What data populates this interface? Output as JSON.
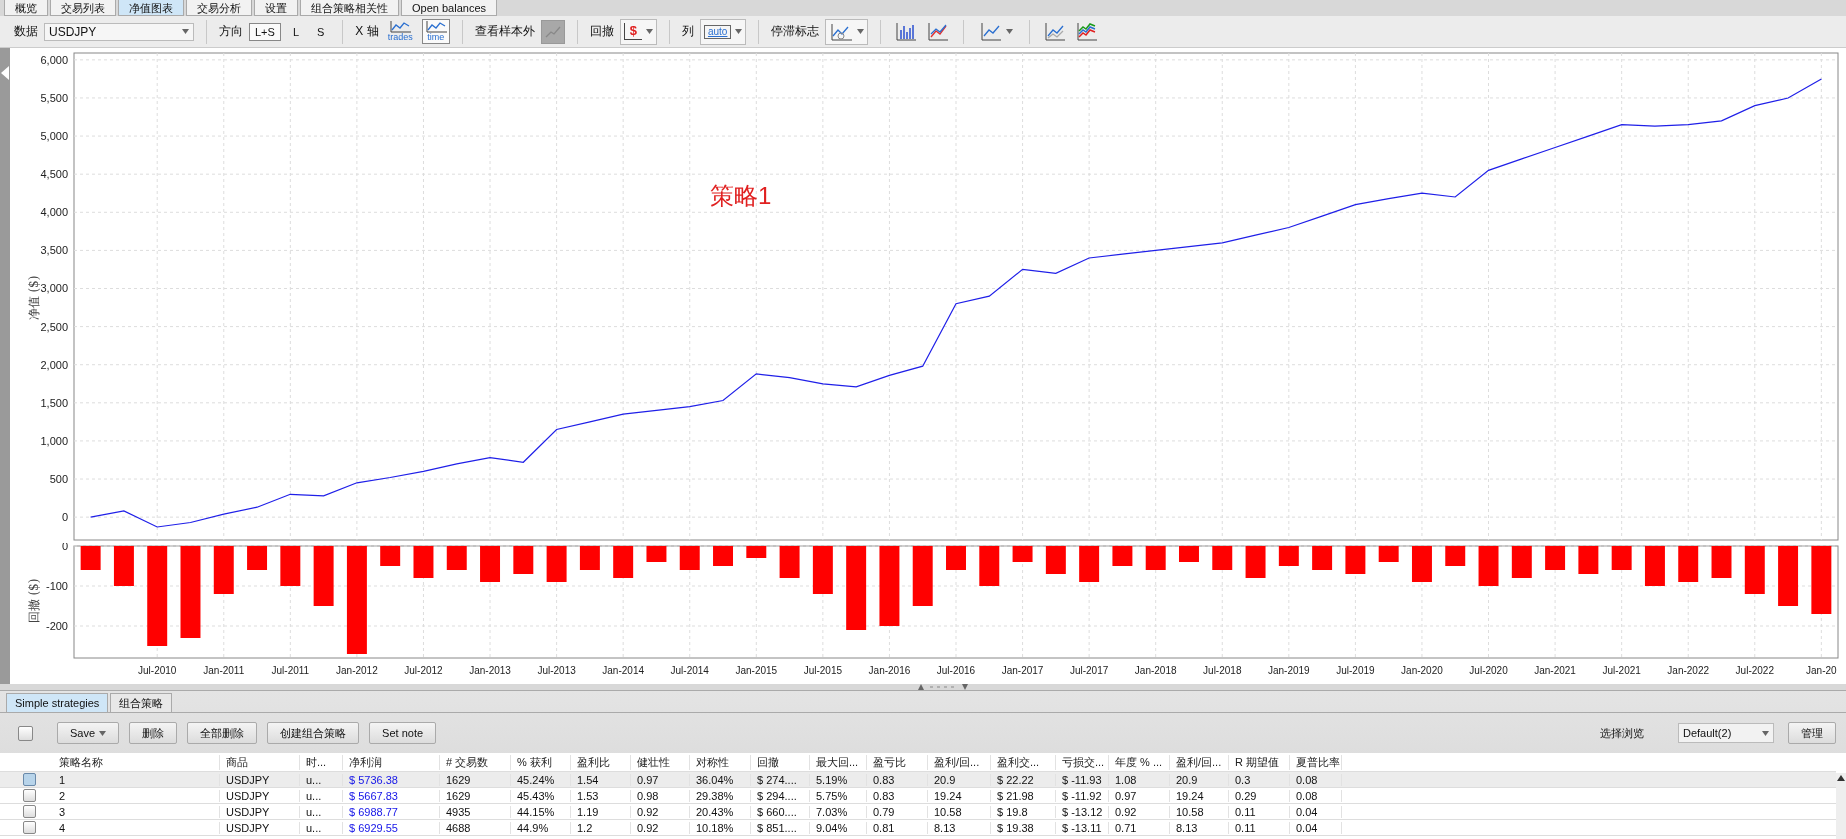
{
  "top_tabs": [
    {
      "label": "概览",
      "selected": false
    },
    {
      "label": "交易列表",
      "selected": false
    },
    {
      "label": "净值图表",
      "selected": true
    },
    {
      "label": "交易分析",
      "selected": false
    },
    {
      "label": "设置",
      "selected": false
    },
    {
      "label": "组合策略相关性",
      "selected": false
    },
    {
      "label": "Open balances",
      "selected": false
    }
  ],
  "toolbar": {
    "data_label": "数据",
    "symbol_select": "USDJPY",
    "direction_label": "方向",
    "direction_options": [
      {
        "label": "L+S",
        "selected": true
      },
      {
        "label": "L",
        "selected": false
      },
      {
        "label": "S",
        "selected": false
      }
    ],
    "x_axis_label": "X 轴",
    "x_axis_options": [
      {
        "label": "trades",
        "selected": false
      },
      {
        "label": "time",
        "selected": true
      }
    ],
    "out_of_sample_label": "查看样本外",
    "drawdown_label": "回撤",
    "drawdown_icon_text": "$",
    "columns_label": "列",
    "columns_icon_text": "auto",
    "stagnation_label": "停滞标志"
  },
  "equity_chart": {
    "chart_data": {
      "type": "line",
      "ylabel": "净值 ($)",
      "grid": true,
      "categories": [
        null,
        null,
        null,
        null,
        null,
        null,
        null,
        null,
        null,
        null,
        null,
        null,
        null,
        null,
        null,
        null,
        null,
        null,
        null,
        null,
        null,
        null,
        null,
        null,
        null,
        null,
        null,
        null,
        null,
        null,
        null,
        null,
        null,
        null,
        null,
        null,
        null,
        null,
        null,
        null,
        null,
        null,
        null,
        null,
        null,
        null,
        null,
        null,
        null,
        null,
        null,
        null,
        null
      ],
      "series": [
        {
          "color": "#1f1fe8",
          "values": [
            0,
            80,
            -130,
            -70,
            40,
            130,
            300,
            280,
            450,
            520,
            600,
            700,
            780,
            720,
            1150,
            1250,
            1350,
            1400,
            1450,
            1530,
            1880,
            1830,
            1750,
            1710,
            1860,
            1980,
            2800,
            2900,
            3250,
            3200,
            3400,
            3450,
            3500,
            3550,
            3600,
            3700,
            3800,
            3950,
            4100,
            4180,
            4250,
            4200,
            4550,
            4700,
            4850,
            5000,
            5150,
            5130,
            5150,
            5200,
            5400,
            5500,
            5750
          ]
        }
      ],
      "ylim": [
        -300,
        6090
      ],
      "yticks": [
        {
          "value": 0,
          "label": "0"
        },
        {
          "value": 500,
          "label": "500"
        },
        {
          "value": 1000,
          "label": "1,000"
        },
        {
          "value": 1500,
          "label": "1,500"
        },
        {
          "value": 2000,
          "label": "2,000"
        },
        {
          "value": 2500,
          "label": "2,500"
        },
        {
          "value": 3000,
          "label": "3,000"
        },
        {
          "value": 3500,
          "label": "3,500"
        },
        {
          "value": 4000,
          "label": "4,000"
        },
        {
          "value": 4500,
          "label": "4,500"
        },
        {
          "value": 5000,
          "label": "5,000"
        },
        {
          "value": 5500,
          "label": "5,500"
        },
        {
          "value": 6000,
          "label": "6,000"
        }
      ],
      "annotations": [
        "策略1"
      ]
    }
  },
  "drawdown_chart": {
    "chart_data": {
      "type": "bar",
      "ylabel": "回撤 ($)",
      "grid": true,
      "categories": [
        null,
        null,
        "Jul-2010",
        null,
        "Jan-2011",
        null,
        "Jul-2011",
        null,
        "Jan-2012",
        null,
        "Jul-2012",
        null,
        "Jan-2013",
        null,
        "Jul-2013",
        null,
        "Jan-2014",
        null,
        "Jul-2014",
        null,
        "Jan-2015",
        null,
        "Jul-2015",
        null,
        "Jan-2016",
        null,
        "Jul-2016",
        null,
        "Jan-2017",
        null,
        "Jul-2017",
        null,
        "Jan-2018",
        null,
        "Jul-2018",
        null,
        "Jan-2019",
        null,
        "Jul-2019",
        null,
        "Jan-2020",
        null,
        "Jul-2020",
        null,
        "Jan-2021",
        null,
        "Jul-2021",
        null,
        "Jan-2022",
        null,
        "Jul-2022",
        null,
        "Jan-20"
      ],
      "series": [
        {
          "color": "#ff0000",
          "values": [
            -60,
            -100,
            -250,
            -230,
            -120,
            -60,
            -100,
            -150,
            -270,
            -50,
            -80,
            -60,
            -90,
            -70,
            -90,
            -60,
            -80,
            -40,
            -60,
            -50,
            -30,
            -80,
            -120,
            -210,
            -200,
            -150,
            -60,
            -100,
            -40,
            -70,
            -90,
            -50,
            -60,
            -40,
            -60,
            -80,
            -50,
            -60,
            -70,
            -40,
            -90,
            -50,
            -100,
            -80,
            -60,
            -70,
            -60,
            -100,
            -90,
            -80,
            -120,
            -150,
            -170
          ]
        }
      ],
      "ylim": [
        -280,
        0
      ],
      "yticks": [
        0,
        -100,
        -200
      ]
    }
  },
  "bottom_tabs": [
    {
      "label": "Simple strategies",
      "selected": true
    },
    {
      "label": "组合策略",
      "selected": false
    }
  ],
  "select_all_checked": false,
  "actions": [
    {
      "label": "Save",
      "kind": "menu"
    },
    {
      "label": "删除",
      "kind": "button"
    },
    {
      "label": "全部删除",
      "kind": "button"
    },
    {
      "label": "创建组合策略",
      "kind": "button"
    },
    {
      "label": "Set note",
      "kind": "button"
    }
  ],
  "view_label": "选择浏览",
  "view_select": "Default(2)",
  "manage_button": "管理",
  "table": {
    "columns": [
      {
        "title": "策略名称",
        "kind": "text"
      },
      {
        "title": "商品",
        "kind": "text"
      },
      {
        "title": "时...",
        "kind": "text"
      },
      {
        "title": "净利润",
        "kind": "money"
      },
      {
        "title": "# 交易数",
        "kind": "text"
      },
      {
        "title": "% 获利",
        "kind": "text"
      },
      {
        "title": "盈利比",
        "kind": "text"
      },
      {
        "title": "健壮性",
        "kind": "text"
      },
      {
        "title": "对称性",
        "kind": "text"
      },
      {
        "title": "回撤",
        "kind": "text"
      },
      {
        "title": "最大回...",
        "kind": "text"
      },
      {
        "title": "盈亏比",
        "kind": "text"
      },
      {
        "title": "盈利/回...",
        "kind": "text"
      },
      {
        "title": "盈利交...",
        "kind": "text"
      },
      {
        "title": "亏损交...",
        "kind": "text"
      },
      {
        "title": "年度 % ...",
        "kind": "text"
      },
      {
        "title": "盈利/回...",
        "kind": "text"
      },
      {
        "title": "R 期望值",
        "kind": "text"
      },
      {
        "title": "夏普比率",
        "kind": "text"
      }
    ],
    "rows": [
      {
        "selected": true,
        "checked": false,
        "cells": [
          "1",
          "USDJPY",
          "u...",
          "$ 5736.38",
          "1629",
          "45.24%",
          "1.54",
          "0.97",
          "36.04%",
          "$ 274....",
          "5.19%",
          "0.83",
          "20.9",
          "$ 22.22",
          "$ -11.93",
          "1.08",
          "20.9",
          "0.3",
          "0.08"
        ]
      },
      {
        "selected": false,
        "checked": false,
        "cells": [
          "2",
          "USDJPY",
          "u...",
          "$ 5667.83",
          "1629",
          "45.43%",
          "1.53",
          "0.98",
          "29.38%",
          "$ 294....",
          "5.75%",
          "0.83",
          "19.24",
          "$ 21.98",
          "$ -11.92",
          "0.97",
          "19.24",
          "0.29",
          "0.08"
        ]
      },
      {
        "selected": false,
        "checked": false,
        "cells": [
          "3",
          "USDJPY",
          "u...",
          "$ 6988.77",
          "4935",
          "44.15%",
          "1.19",
          "0.92",
          "20.43%",
          "$ 660....",
          "7.03%",
          "0.79",
          "10.58",
          "$ 19.8",
          "$ -13.12",
          "0.92",
          "10.58",
          "0.11",
          "0.04"
        ]
      },
      {
        "selected": false,
        "checked": false,
        "cells": [
          "4",
          "USDJPY",
          "u...",
          "$ 6929.55",
          "4688",
          "44.9%",
          "1.2",
          "0.92",
          "10.18%",
          "$ 851....",
          "9.04%",
          "0.81",
          "8.13",
          "$ 19.38",
          "$ -13.11",
          "0.71",
          "8.13",
          "0.11",
          "0.04"
        ]
      }
    ]
  }
}
